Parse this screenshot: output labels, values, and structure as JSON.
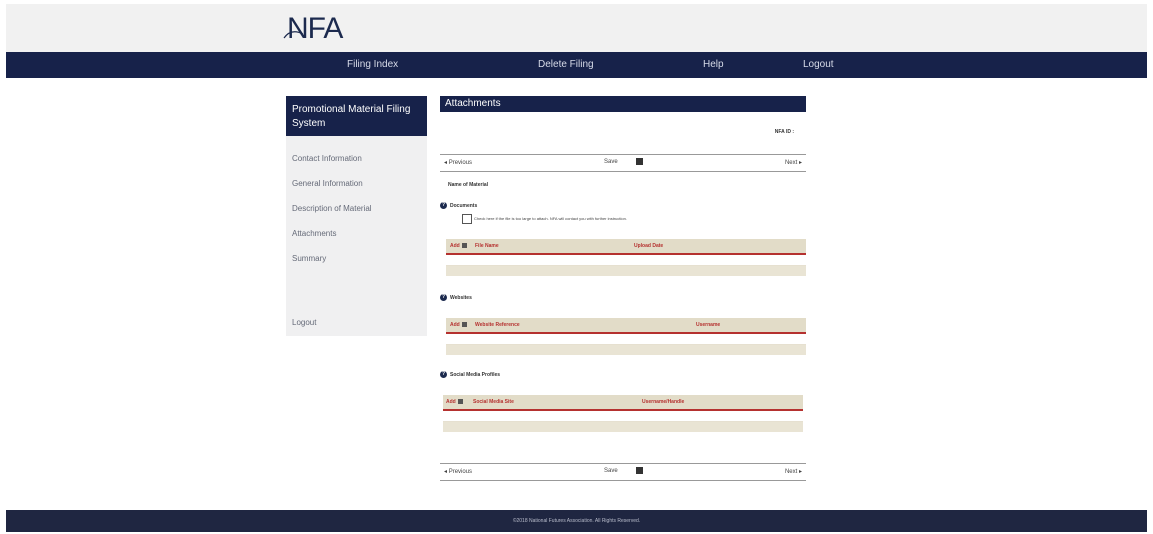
{
  "brand": {
    "logo_text": "NFA"
  },
  "nav": {
    "items": [
      "Filing Index",
      "Delete Filing",
      "Help",
      "Logout"
    ]
  },
  "sidebar": {
    "title": "Promotional Material Filing System",
    "links": [
      "Contact Information",
      "General Information",
      "Description of Material",
      "Attachments",
      "Summary"
    ],
    "logout": "Logout"
  },
  "main": {
    "section_title": "Attachments",
    "nfa_id_label": "NFA ID :",
    "pager": {
      "previous": "Previous",
      "save": "Save",
      "next": "Next"
    },
    "name_of_material_label": "Name of Material",
    "documents": {
      "label": "Documents",
      "checkbox_note": "Check here if the file is too large to attach. NFA will contact you with further instruction.",
      "columns": [
        "Add",
        "File Name",
        "Upload Date"
      ]
    },
    "websites": {
      "label": "Websites",
      "columns": [
        "Add",
        "Website Reference",
        "Username"
      ]
    },
    "social": {
      "label": "Social Media Profiles",
      "columns": [
        "Add",
        "Social Media Site",
        "Username/Handle"
      ]
    }
  },
  "footer": {
    "text": "©2018 National Futures Association. All Rights Reserved."
  },
  "colors": {
    "navy": "#17224a",
    "tan": "#e2dcc8",
    "accent_red": "#b5312f"
  }
}
